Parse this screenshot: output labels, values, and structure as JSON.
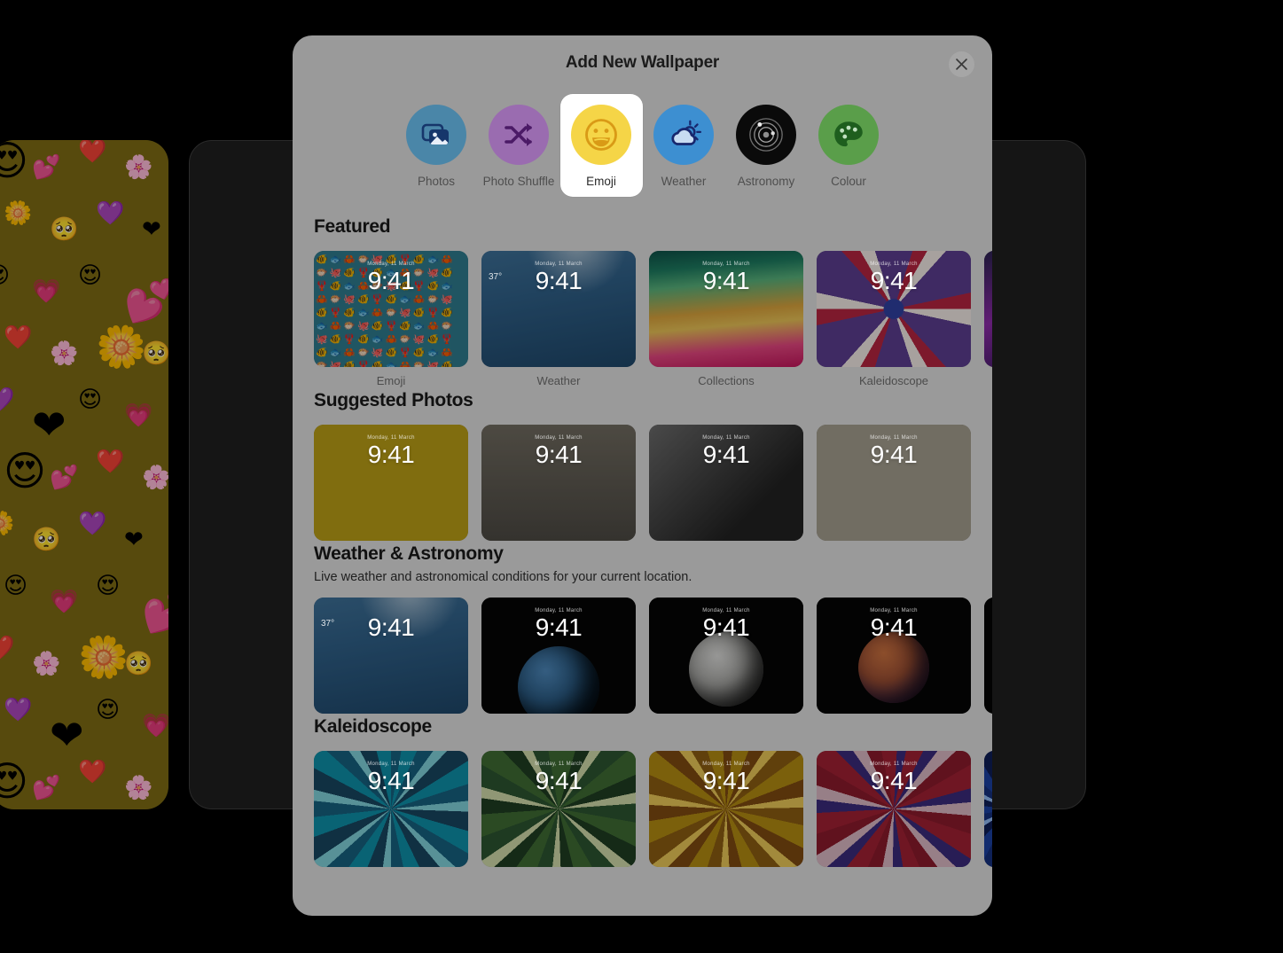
{
  "background": {
    "wallpaper_name": "emoji-wallpaper",
    "wallpaper_color": "#7d6b14",
    "emojis": [
      "😍",
      "💕",
      "❤️",
      "🌸",
      "🌼",
      "🥺",
      "💜",
      "❤",
      "😍",
      "💗"
    ],
    "panel_color": "#151515"
  },
  "modal": {
    "title": "Add New Wallpaper",
    "close_label": "×",
    "background_color": "#9a9a9a"
  },
  "categories": [
    {
      "label": "Photos",
      "icon": "photos-icon",
      "color": "#4a86a8",
      "selected": false
    },
    {
      "label": "Photo Shuffle",
      "icon": "shuffle-icon",
      "color": "#9a6cb0",
      "selected": false
    },
    {
      "label": "Emoji",
      "icon": "emoji-smiley-icon",
      "color": "#f5d547",
      "selected": true
    },
    {
      "label": "Weather",
      "icon": "weather-cloud-sun-icon",
      "color": "#3d8fd1",
      "selected": false
    },
    {
      "label": "Astronomy",
      "icon": "astronomy-orbit-icon",
      "color": "#0a0a0a",
      "selected": false
    },
    {
      "label": "Colour",
      "icon": "colour-palette-icon",
      "color": "#5a9e4a",
      "selected": false
    }
  ],
  "sections": [
    {
      "title": "Featured",
      "subtitle": "",
      "items": [
        {
          "caption": "Emoji",
          "art": "art-emoji",
          "time": "9:41",
          "date": "Monday, 11 March",
          "weather": ""
        },
        {
          "caption": "Weather",
          "art": "art-weather",
          "time": "9:41",
          "date": "Monday, 11 March",
          "weather": "37°"
        },
        {
          "caption": "Collections",
          "art": "art-collections",
          "time": "9:41",
          "date": "Monday, 11 March",
          "weather": ""
        },
        {
          "caption": "Kaleidoscope",
          "art": "art-kaleido",
          "time": "9:41",
          "date": "Monday, 11 March",
          "weather": ""
        },
        {
          "caption": "",
          "art": "art-purple",
          "time": "",
          "date": "",
          "weather": "",
          "partial": true
        }
      ]
    },
    {
      "title": "Suggested Photos",
      "subtitle": "",
      "items": [
        {
          "caption": "",
          "art": "art-photo-yellow",
          "time": "9:41",
          "date": "Monday, 11 March",
          "weather": ""
        },
        {
          "caption": "",
          "art": "art-photo-gray",
          "time": "9:41",
          "date": "Monday, 11 March",
          "weather": ""
        },
        {
          "caption": "",
          "art": "art-photo-bw",
          "time": "9:41",
          "date": "Monday, 11 March",
          "weather": ""
        },
        {
          "caption": "",
          "art": "art-photo-beige",
          "time": "9:41",
          "date": "Monday, 11 March",
          "weather": ""
        }
      ]
    },
    {
      "title": "Weather & Astronomy",
      "subtitle": "Live weather and astronomical conditions for your current location.",
      "items": [
        {
          "caption": "",
          "art": "art-weather",
          "time": "9:41",
          "date": "",
          "weather": "37°"
        },
        {
          "caption": "",
          "art": "art-earth",
          "time": "9:41",
          "date": "Monday, 11 March",
          "weather": ""
        },
        {
          "caption": "",
          "art": "art-moon",
          "time": "9:41",
          "date": "Monday, 11 March",
          "weather": ""
        },
        {
          "caption": "",
          "art": "art-mars",
          "time": "9:41",
          "date": "Monday, 11 March",
          "weather": ""
        },
        {
          "caption": "",
          "art": "art-dark",
          "time": "",
          "date": "",
          "weather": "",
          "partial": true
        }
      ]
    },
    {
      "title": "Kaleidoscope",
      "subtitle": "",
      "items": [
        {
          "caption": "",
          "art": "art-k-teal",
          "time": "9:41",
          "date": "Monday, 11 March",
          "weather": ""
        },
        {
          "caption": "",
          "art": "art-k-green",
          "time": "9:41",
          "date": "Monday, 11 March",
          "weather": ""
        },
        {
          "caption": "",
          "art": "art-k-gold",
          "time": "9:41",
          "date": "Monday, 11 March",
          "weather": ""
        },
        {
          "caption": "",
          "art": "art-k-red",
          "time": "9:41",
          "date": "Monday, 11 March",
          "weather": ""
        },
        {
          "caption": "",
          "art": "art-k-blue",
          "time": "",
          "date": "",
          "weather": "",
          "partial": true
        }
      ]
    }
  ]
}
